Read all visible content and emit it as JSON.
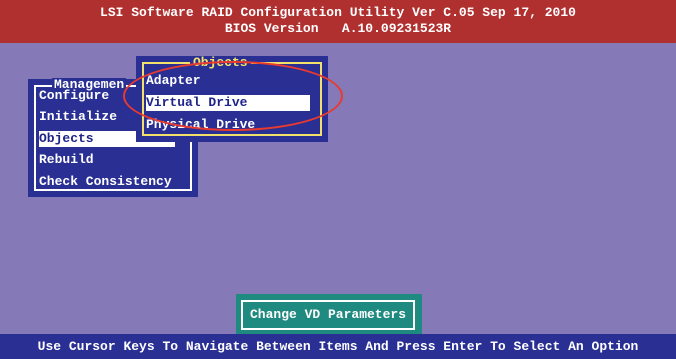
{
  "title_bar": {
    "line1": "LSI Software RAID Configuration Utility Ver C.05 Sep 17, 2010",
    "line2": "BIOS Version   A.10.09231523R",
    "background": "#b02f2f"
  },
  "management_menu": {
    "title": "Managemen",
    "items": [
      {
        "label": "Configure",
        "selected": false
      },
      {
        "label": "Initialize",
        "selected": false
      },
      {
        "label": "Objects",
        "selected": true
      },
      {
        "label": "Rebuild",
        "selected": false
      },
      {
        "label": "Check Consistency",
        "selected": false
      }
    ]
  },
  "objects_menu": {
    "title": "Objects",
    "items": [
      {
        "label": "Adapter",
        "selected": false
      },
      {
        "label": "Virtual Drive",
        "selected": true
      },
      {
        "label": "Physical Drive",
        "selected": false
      }
    ],
    "border_color": "#f1e06a"
  },
  "action_button": {
    "label": "Change VD Parameters",
    "background": "#1f8a7f"
  },
  "status_bar": {
    "text": "Use Cursor Keys To Navigate Between Items And Press Enter To Select An Option"
  },
  "colors": {
    "background": "#8579b7",
    "panel": "#2a2f94",
    "highlight": "#e83a2e"
  }
}
